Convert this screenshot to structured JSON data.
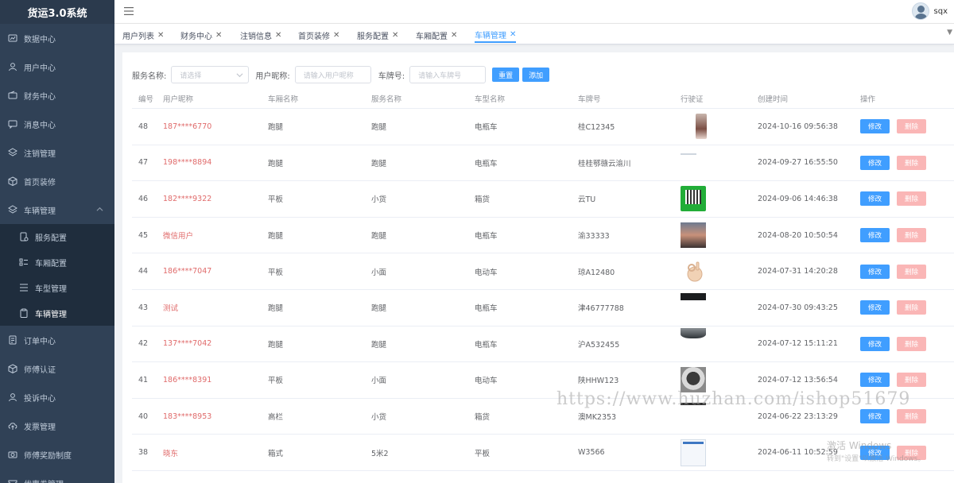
{
  "app": {
    "title": "货运3.0系统"
  },
  "sidebar": {
    "items": [
      {
        "label": "数据中心",
        "icon": "dashboard-icon"
      },
      {
        "label": "用户中心",
        "icon": "user-icon"
      },
      {
        "label": "财务中心",
        "icon": "wallet-icon"
      },
      {
        "label": "消息中心",
        "icon": "message-icon"
      },
      {
        "label": "注销管理",
        "icon": "layers-icon"
      },
      {
        "label": "首页装修",
        "icon": "box-icon"
      },
      {
        "label": "车辆管理",
        "icon": "layers-icon",
        "open": true
      }
    ],
    "sub_items": [
      {
        "label": "服务配置",
        "icon": "doc-gear-icon"
      },
      {
        "label": "车厢配置",
        "icon": "list-icon"
      },
      {
        "label": "车型管理",
        "icon": "grid-icon"
      },
      {
        "label": "车辆管理",
        "icon": "clipboard-icon",
        "active": true
      }
    ],
    "items_after": [
      {
        "label": "订单中心",
        "icon": "order-icon"
      },
      {
        "label": "师傅认证",
        "icon": "box-icon"
      },
      {
        "label": "投诉中心",
        "icon": "user-icon"
      },
      {
        "label": "发票管理",
        "icon": "upload-cloud-icon"
      },
      {
        "label": "师傅奖励制度",
        "icon": "camera-icon"
      },
      {
        "label": "优惠券管理",
        "icon": "ticket-icon"
      }
    ]
  },
  "header": {
    "username": "sqx"
  },
  "tabs": [
    {
      "label": "用户列表",
      "active": false
    },
    {
      "label": "财务中心",
      "active": false
    },
    {
      "label": "注销信息",
      "active": false
    },
    {
      "label": "首页装修",
      "active": false
    },
    {
      "label": "服务配置",
      "active": false
    },
    {
      "label": "车厢配置",
      "active": false
    },
    {
      "label": "车辆管理",
      "active": true
    }
  ],
  "filters": {
    "service_label": "服务名称:",
    "service_placeholder": "请选择",
    "nick_label": "用户昵称:",
    "nick_placeholder": "请输入用户昵称",
    "plate_label": "车牌号:",
    "plate_placeholder": "请输入车牌号",
    "reset_label": "重置",
    "add_label": "添加"
  },
  "table": {
    "headers": {
      "id": "编号",
      "nick": "用户昵称",
      "cabin": "车厢名称",
      "service": "服务名称",
      "type": "车型名称",
      "plate": "车牌号",
      "license": "行驶证",
      "created": "创建时间",
      "ops": "操作"
    },
    "edit_label": "修改",
    "delete_label": "删除",
    "rows": [
      {
        "id": "48",
        "nick": "187****6770",
        "cabin": "跑腿",
        "service": "跑腿",
        "type": "电瓶车",
        "plate": "桂C12345",
        "thumb": "phone",
        "created": "2024-10-16 09:56:38"
      },
      {
        "id": "47",
        "nick": "198****8894",
        "cabin": "跑腿",
        "service": "跑腿",
        "type": "电瓶车",
        "plate": "桂桂鄂赣云渝川",
        "thumb": "thin",
        "created": "2024-09-27 16:55:50"
      },
      {
        "id": "46",
        "nick": "182****9322",
        "cabin": "平板",
        "service": "小货",
        "type": "箱货",
        "plate": "云TU",
        "thumb": "qr",
        "created": "2024-09-06 14:46:38"
      },
      {
        "id": "45",
        "nick": "微信用户",
        "cabin": "跑腿",
        "service": "跑腿",
        "type": "电瓶车",
        "plate": "渝33333",
        "thumb": "sunset",
        "created": "2024-08-20 10:50:54"
      },
      {
        "id": "44",
        "nick": "186****7047",
        "cabin": "平板",
        "service": "小面",
        "type": "电动车",
        "plate": "琼A12480",
        "thumb": "hand",
        "created": "2024-07-31 14:20:28"
      },
      {
        "id": "43",
        "nick": "测试",
        "cabin": "跑腿",
        "service": "跑腿",
        "type": "电瓶车",
        "plate": "津46777788",
        "thumb": "dark",
        "created": "2024-07-30 09:43:25"
      },
      {
        "id": "42",
        "nick": "137****7042",
        "cabin": "跑腿",
        "service": "跑腿",
        "type": "电瓶车",
        "plate": "沪A532455",
        "thumb": "car",
        "created": "2024-07-12 15:11:21"
      },
      {
        "id": "41",
        "nick": "186****8391",
        "cabin": "平板",
        "service": "小面",
        "type": "电动车",
        "plate": "陕HHW123",
        "thumb": "dog",
        "created": "2024-07-12 13:56:54"
      },
      {
        "id": "40",
        "nick": "183****8953",
        "cabin": "高栏",
        "service": "小货",
        "type": "箱货",
        "plate": "澳MK2353",
        "thumb": "bar",
        "created": "2024-06-22 23:13:29"
      },
      {
        "id": "38",
        "nick": "晓东",
        "cabin": "箱式",
        "service": "5米2",
        "type": "平板",
        "plate": "W3566",
        "thumb": "doc",
        "created": "2024-06-11 10:52:59"
      }
    ]
  },
  "overlays": {
    "watermark": "https://www.huzhan.com/ishop51679",
    "activate_title": "激活 Windows",
    "activate_sub": "转到\"设置\"以激活 Windows。"
  },
  "colors": {
    "sidebar_bg": "#304156",
    "primary": "#409eff",
    "danger_light": "#fab6b6",
    "nick_text": "#e06b6b"
  }
}
